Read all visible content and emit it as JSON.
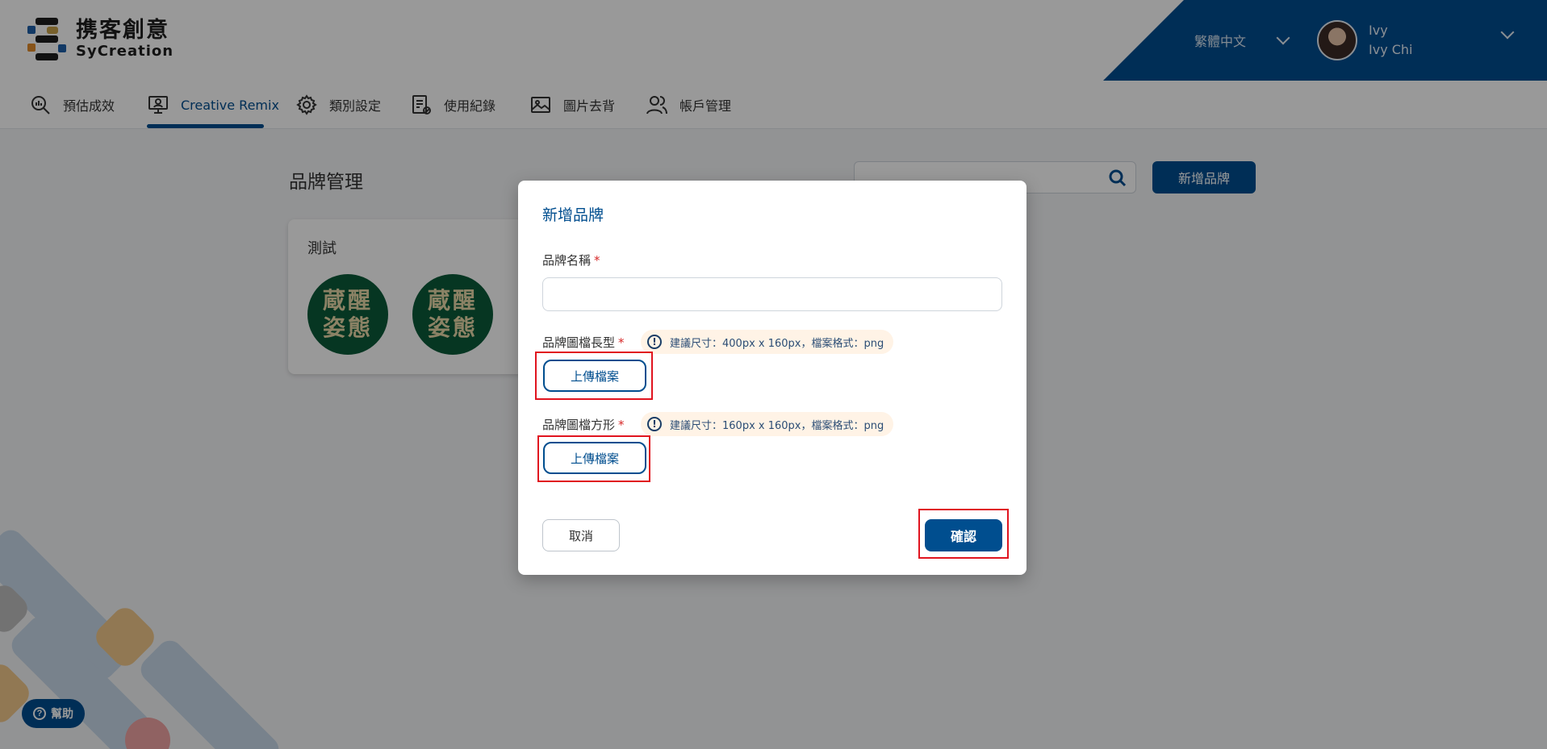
{
  "logo": {
    "cn": "携客創意",
    "en": "SyCreation"
  },
  "header": {
    "language": "繁體中文",
    "user": {
      "name": "Ivy",
      "full_name": "Ivy Chi"
    }
  },
  "nav": {
    "items": [
      {
        "label": "預估成效",
        "icon": "chart-search-icon"
      },
      {
        "label": "Creative Remix",
        "icon": "monitor-user-icon",
        "active": true
      },
      {
        "label": "類別設定",
        "icon": "gear-icon"
      },
      {
        "label": "使用紀錄",
        "icon": "document-check-icon"
      },
      {
        "label": "圖片去背",
        "icon": "image-icon"
      },
      {
        "label": "帳戶管理",
        "icon": "users-icon"
      }
    ]
  },
  "page": {
    "title": "品牌管理",
    "search_placeholder": "",
    "add_button": "新增品牌",
    "card": {
      "title": "測試",
      "logo_line1": "蔵醒",
      "logo_line2": "姿態"
    }
  },
  "help": {
    "label": "幫助"
  },
  "modal": {
    "title": "新增品牌",
    "name_label": "品牌名稱",
    "long_logo_label": "品牌圖檔長型",
    "long_logo_hint": "建議尺寸：400px x 160px，檔案格式：png",
    "square_logo_label": "品牌圖檔方形",
    "square_logo_hint": "建議尺寸：160px x 160px，檔案格式：png",
    "upload_label": "上傳檔案",
    "required_mark": "*",
    "cancel": "取消",
    "confirm": "確認"
  },
  "colors": {
    "brand": "#004e8f",
    "highlight": "#e0141f",
    "hint_bg": "#fff3e6"
  }
}
